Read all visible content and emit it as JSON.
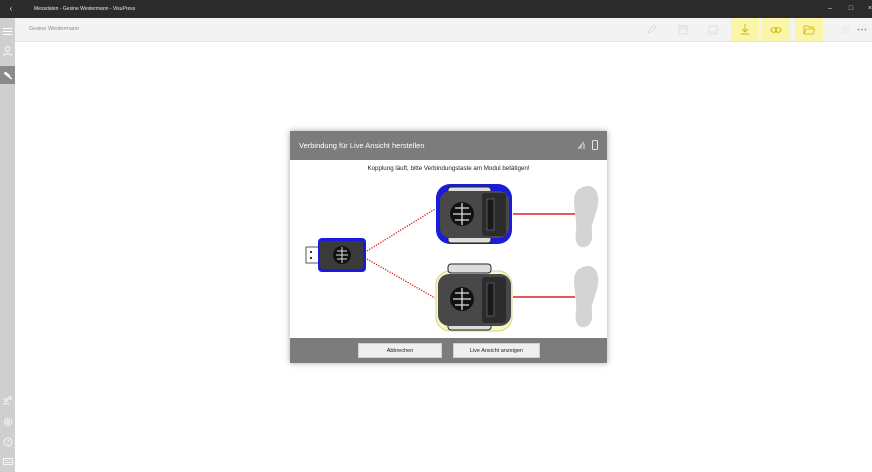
{
  "window": {
    "title": "Messdaten - Gesine Westermann - VisuPress",
    "back_icon": "arrow-left-icon"
  },
  "toolbar": {
    "patient_name": "Gesine Westermann"
  },
  "dialog": {
    "title": "Verbindung für Live Ansicht herstellen",
    "message": "Kopplung läuft, bitte Verbindungstaste am Modul betätigen!",
    "cancel_label": "Abbrechen",
    "confirm_label": "Live Ansicht anzeigen"
  },
  "colors": {
    "highlight": "#fbf5a9",
    "sensor_blue": "#1b1bdc",
    "connection_red": "#e02020"
  },
  "icons": {
    "sidebar_top": [
      "user-icon",
      "sensor-icon"
    ],
    "sidebar_bottom": [
      "users-icon",
      "gear-icon",
      "help-icon",
      "keyboard-icon"
    ],
    "toolbar": [
      "pen-icon",
      "save-icon",
      "save-as-icon",
      "download-icon",
      "link-icon",
      "folder-open-icon",
      "record-icon",
      "more-icon"
    ]
  }
}
